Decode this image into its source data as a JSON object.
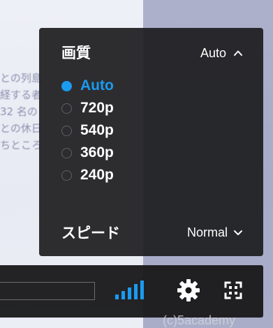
{
  "background_text": {
    "lines": [
      "との列島",
      "経する者",
      "32 名の",
      "との休日",
      "ちところ"
    ]
  },
  "settings_menu": {
    "title": "画質",
    "current_quality": "Auto",
    "quality_options": [
      {
        "label": "Auto",
        "selected": true
      },
      {
        "label": "720p",
        "selected": false
      },
      {
        "label": "540p",
        "selected": false
      },
      {
        "label": "360p",
        "selected": false
      },
      {
        "label": "240p",
        "selected": false
      }
    ],
    "speed_label": "スピード",
    "speed_value": "Normal"
  },
  "control_bar": {
    "quality_indicator_icon": "signal-bars-icon",
    "settings_icon": "gear-icon",
    "fullscreen_icon": "fullscreen-icon"
  },
  "watermark": "(c)5academy",
  "colors": {
    "accent": "#1a9bf0",
    "menu_bg": "#1c1c1e",
    "text": "#ffffff"
  }
}
